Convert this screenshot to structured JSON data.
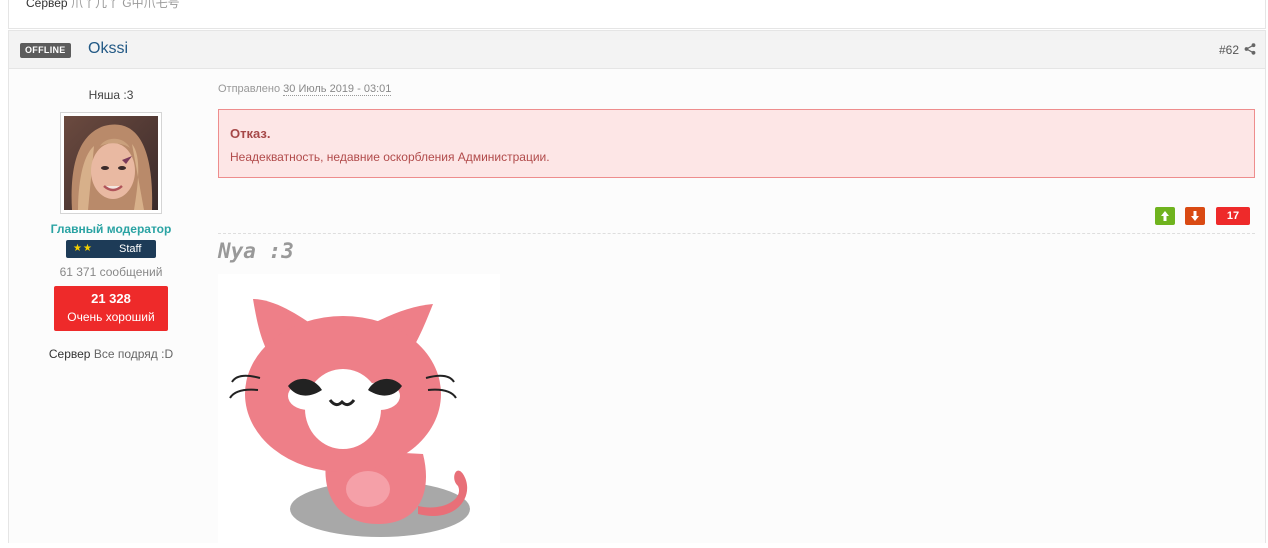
{
  "previous_post": {
    "server_label": "Сервер",
    "server_value": "爪丫几丫 G中爪乇号"
  },
  "post": {
    "status_badge": "OFFLINE",
    "author": "Okssi",
    "post_number": "#62",
    "share_icon": "share-icon",
    "author_info": {
      "title": "Няша :3",
      "group": "Главный модератор",
      "rank_stars": "★★",
      "rank_label": "Staff",
      "posts_count": "61 371 сообщений",
      "reputation_value": "21 328",
      "reputation_label": "Очень хороший",
      "server_label": "Сервер",
      "server_value": "Все подряд :D"
    },
    "posted_prefix": "Отправлено",
    "posted_date": "30 Июль 2019 - 03:01",
    "warning": {
      "title": "Отказ.",
      "message": "Неадекватность, недавние оскорбления Администрации."
    },
    "votes": {
      "up_icon": "arrow-up-icon",
      "down_icon": "arrow-down-icon",
      "count": "17"
    },
    "signature_title": "Nya :3",
    "colors": {
      "author_link": "#225985",
      "group": "#2aa3a3",
      "rank_bg": "#1d3b57",
      "reputation_bg": "#ee2a2a",
      "warning_bg": "#fde6e6",
      "warning_border": "#ee8d8d",
      "vote_up": "#6fb31e",
      "vote_down": "#d94a13"
    }
  }
}
